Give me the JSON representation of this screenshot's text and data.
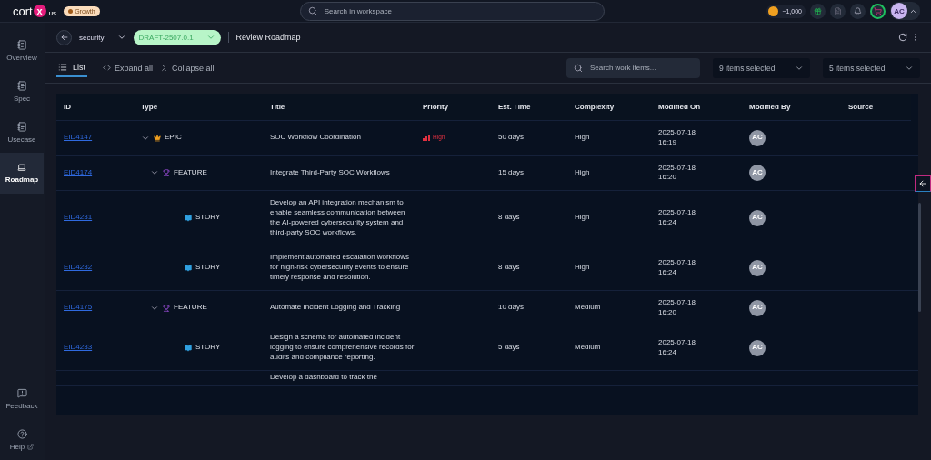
{
  "topbar": {
    "logo": {
      "text": "cort",
      "mark": "x",
      "region": "us"
    },
    "plan_badge": "Growth",
    "search": {
      "placeholder": "Search in workspace"
    },
    "credits": "~1,000",
    "avatar": "AC"
  },
  "sidebar": {
    "items": [
      {
        "label": "Overview",
        "selected": false
      },
      {
        "label": "Spec",
        "selected": false
      },
      {
        "label": "Usecase",
        "selected": false
      },
      {
        "label": "Roadmap",
        "selected": true
      }
    ],
    "bottom_items": [
      {
        "label": "Feedback",
        "kind": "feedback"
      },
      {
        "label": "Help",
        "kind": "help"
      }
    ]
  },
  "header": {
    "project": "security",
    "version": "DRAFT-2507.0.1",
    "title": "Review Roadmap"
  },
  "toolbar": {
    "tabs": [
      {
        "label": "List",
        "selected": true
      }
    ],
    "expand_all": "Expand all",
    "collapse_all": "Collapse all",
    "search": {
      "placeholder": "Search work items..."
    },
    "filters": [
      "9 items selected",
      "5 items selected"
    ]
  },
  "table": {
    "columns": [
      "ID",
      "Type",
      "Title",
      "Priority",
      "Est. Time",
      "Complexity",
      "Modified On",
      "Modified By",
      "Source"
    ],
    "rows": [
      {
        "id": "EID4147",
        "kind": "epic",
        "type": "EPIC",
        "expanded": true,
        "title": "SOC Workflow Coordination",
        "priority": "High",
        "est_time": "50 days",
        "complexity": "High",
        "modified_on": [
          "2025-07-18",
          "16:19"
        ],
        "modified_by": "AC",
        "children": [
          {
            "id": "EID4174",
            "kind": "feature",
            "type": "FEATURE",
            "expanded": true,
            "title": "Integrate Third-Party SOC Workflows",
            "est_time": "15 days",
            "complexity": "High",
            "modified_on": [
              "2025-07-18",
              "16:20"
            ],
            "modified_by": "AC",
            "children": [
              {
                "id": "EID4231",
                "kind": "story",
                "type": "STORY",
                "title": "Develop an API integration mechanism to enable seamless communication between the AI-powered cybersecurity system and third-party SOC workflows.",
                "est_time": "8 days",
                "complexity": "High",
                "modified_on": [
                  "2025-07-18",
                  "16:24"
                ],
                "modified_by": "AC"
              },
              {
                "id": "EID4232",
                "kind": "story",
                "type": "STORY",
                "title": "Implement automated escalation workflows for high-risk cybersecurity events to ensure timely response and resolution.",
                "est_time": "8 days",
                "complexity": "High",
                "modified_on": [
                  "2025-07-18",
                  "16:24"
                ],
                "modified_by": "AC"
              }
            ]
          },
          {
            "id": "EID4175",
            "kind": "feature",
            "type": "FEATURE",
            "expanded": true,
            "title": "Automate Incident Logging and Tracking",
            "est_time": "10 days",
            "complexity": "Medium",
            "modified_on": [
              "2025-07-18",
              "16:20"
            ],
            "modified_by": "AC",
            "children": [
              {
                "id": "EID4233",
                "kind": "story",
                "type": "STORY",
                "title": "Design a schema for automated incident logging to ensure comprehensive records for audits and compliance reporting.",
                "est_time": "5 days",
                "complexity": "Medium",
                "modified_on": [
                  "2025-07-18",
                  "16:24"
                ],
                "modified_by": "AC"
              },
              {
                "kind": "partial",
                "title": "Develop a dashboard to track the"
              }
            ]
          }
        ]
      }
    ]
  }
}
